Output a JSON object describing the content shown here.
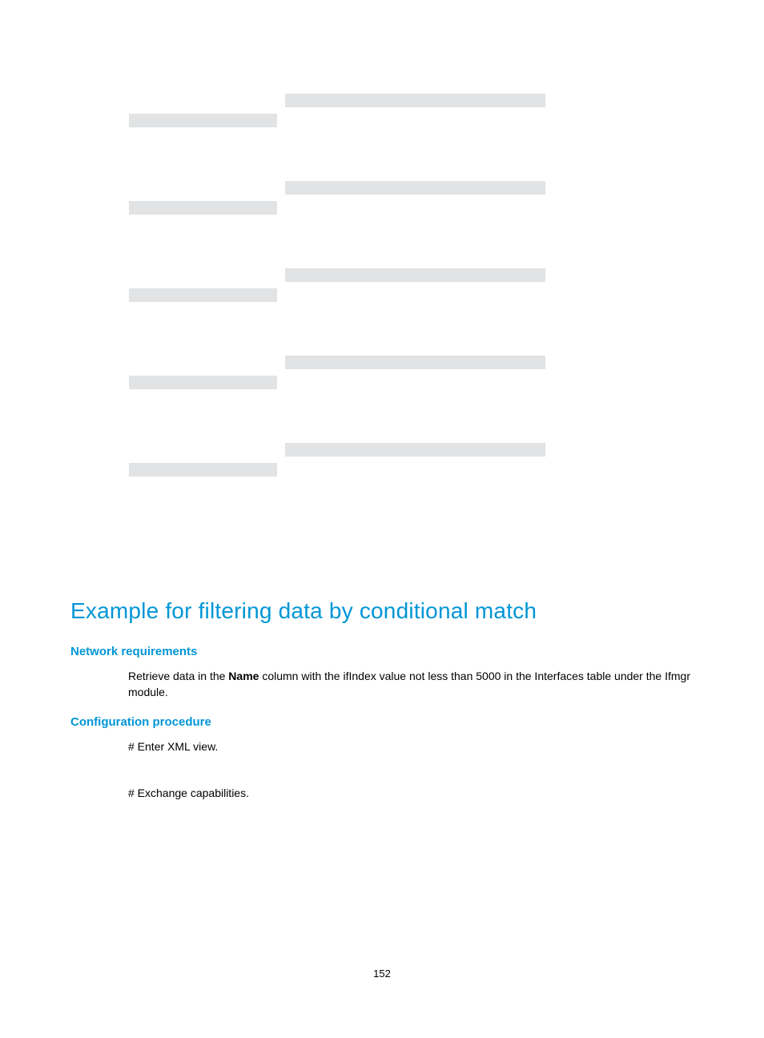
{
  "section_title": "Example for filtering data by conditional match",
  "sub_network_req": "Network requirements",
  "para_retrieve_pre": "Retrieve data in the ",
  "para_retrieve_bold": "Name",
  "para_retrieve_post": " column with the ifIndex value not less than 5000 in the Interfaces table under the Ifmgr module.",
  "sub_config_proc": "Configuration procedure",
  "step_enter_xml": "# Enter XML view.",
  "step_exchange": "# Exchange capabilities.",
  "page_number": "152"
}
